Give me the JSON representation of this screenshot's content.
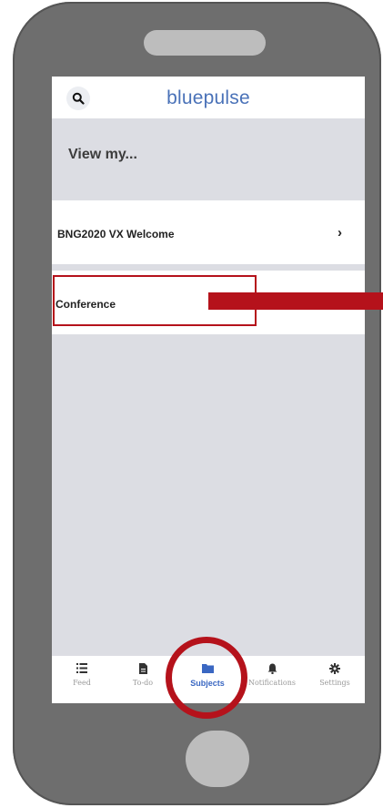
{
  "app": {
    "brand": "bluepulse"
  },
  "header": {
    "search_icon": "search-icon"
  },
  "section": {
    "title": "View my..."
  },
  "subjects": [
    {
      "label": "BNG2020 VX  Welcome",
      "chevron": "›"
    },
    {
      "label": "Conference"
    }
  ],
  "tabs": [
    {
      "label": "Feed",
      "icon": "list-icon"
    },
    {
      "label": "To-do",
      "icon": "document-icon"
    },
    {
      "label": "Subjects",
      "icon": "folder-icon",
      "active": true
    },
    {
      "label": "Notifications",
      "icon": "bell-icon"
    },
    {
      "label": "Settings",
      "icon": "gear-icon"
    }
  ],
  "colors": {
    "brand": "#4a72b8",
    "active_tab": "#3a67c2",
    "highlight": "#b5121b",
    "panel_gray": "#dcdde3",
    "phone_body": "#6e6e6e"
  }
}
